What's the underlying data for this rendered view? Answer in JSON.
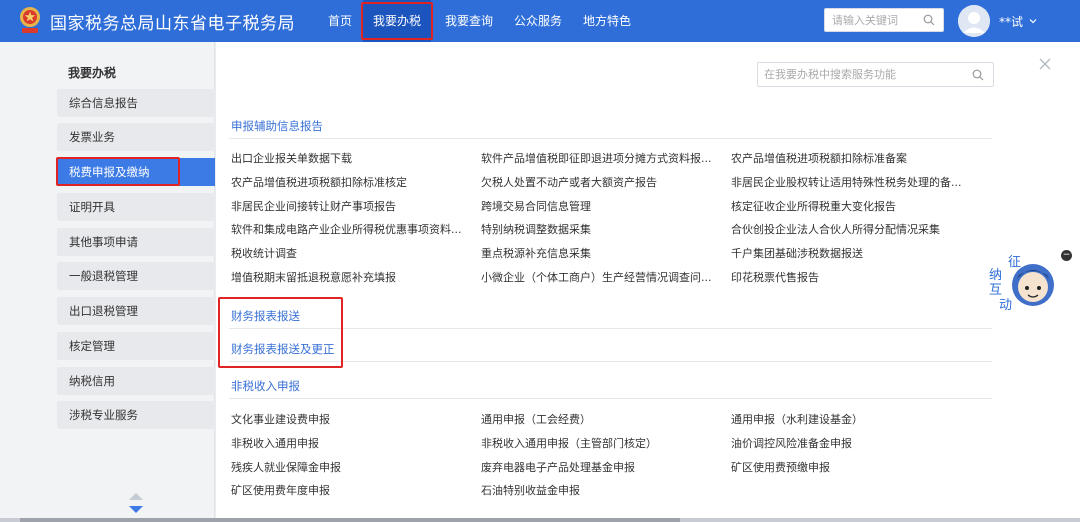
{
  "header": {
    "site_title": "国家税务总局山东省电子税务局",
    "nav": [
      {
        "label": "首页",
        "active": false
      },
      {
        "label": "我要办税",
        "active": true
      },
      {
        "label": "我要查询",
        "active": false
      },
      {
        "label": "公众服务",
        "active": false
      },
      {
        "label": "地方特色",
        "active": false
      }
    ],
    "search_placeholder": "请输入关键词",
    "user_name": "**试",
    "brand_color": "#2f6ed8",
    "highlight_color": "#e02424"
  },
  "sidebar": {
    "title": "我要办税",
    "items": [
      {
        "label": "综合信息报告",
        "active": false
      },
      {
        "label": "发票业务",
        "active": false
      },
      {
        "label": "税费申报及缴纳",
        "active": true
      },
      {
        "label": "证明开具",
        "active": false
      },
      {
        "label": "其他事项申请",
        "active": false
      },
      {
        "label": "一般退税管理",
        "active": false
      },
      {
        "label": "出口退税管理",
        "active": false
      },
      {
        "label": "核定管理",
        "active": false
      },
      {
        "label": "纳税信用",
        "active": false
      },
      {
        "label": "涉税专业服务",
        "active": false
      }
    ]
  },
  "main": {
    "search_placeholder": "在我要办税中搜索服务功能",
    "sections": [
      {
        "title": "申报辅助信息报告",
        "links": [
          [
            "出口企业报关单数据下载",
            "软件产品增值税即征即退进项分摊方式资料报...",
            "农产品增值税进项税额扣除标准备案"
          ],
          [
            "农产品增值税进项税额扣除标准核定",
            "欠税人处置不动产或者大额资产报告",
            "非居民企业股权转让适用特殊性税务处理的备..."
          ],
          [
            "非居民企业间接转让财产事项报告",
            "跨境交易合同信息管理",
            "核定征收企业所得税重大变化报告"
          ],
          [
            "软件和集成电路产业企业所得税优惠事项资料...",
            "特别纳税调整数据采集",
            "合伙创投企业法人合伙人所得分配情况采集"
          ],
          [
            "税收统计调查",
            "重点税源补充信息采集",
            "千户集团基础涉税数据报送"
          ],
          [
            "增值税期末留抵退税意愿补充填报",
            "小微企业（个体工商户）生产经营情况调查问...",
            "印花税票代售报告"
          ]
        ]
      },
      {
        "title": "财务报表报送",
        "links": []
      },
      {
        "title": "财务报表报送及更正",
        "links": []
      },
      {
        "title": "非税收入申报",
        "links": [
          [
            "文化事业建设费申报",
            "通用申报（工会经费）",
            "通用申报（水利建设基金）"
          ],
          [
            "非税收入通用申报",
            "非税收入通用申报（主管部门核定）",
            "油价调控风险准备金申报"
          ],
          [
            "残疾人就业保障金申报",
            "废弃电器电子产品处理基金申报",
            "矿区使用费预缴申报"
          ],
          [
            "矿区使用费年度申报",
            "石油特别收益金申报",
            ""
          ]
        ]
      }
    ]
  },
  "float_widget": {
    "chars": [
      "征",
      "纳",
      "互",
      "动"
    ],
    "close_label": "−"
  }
}
